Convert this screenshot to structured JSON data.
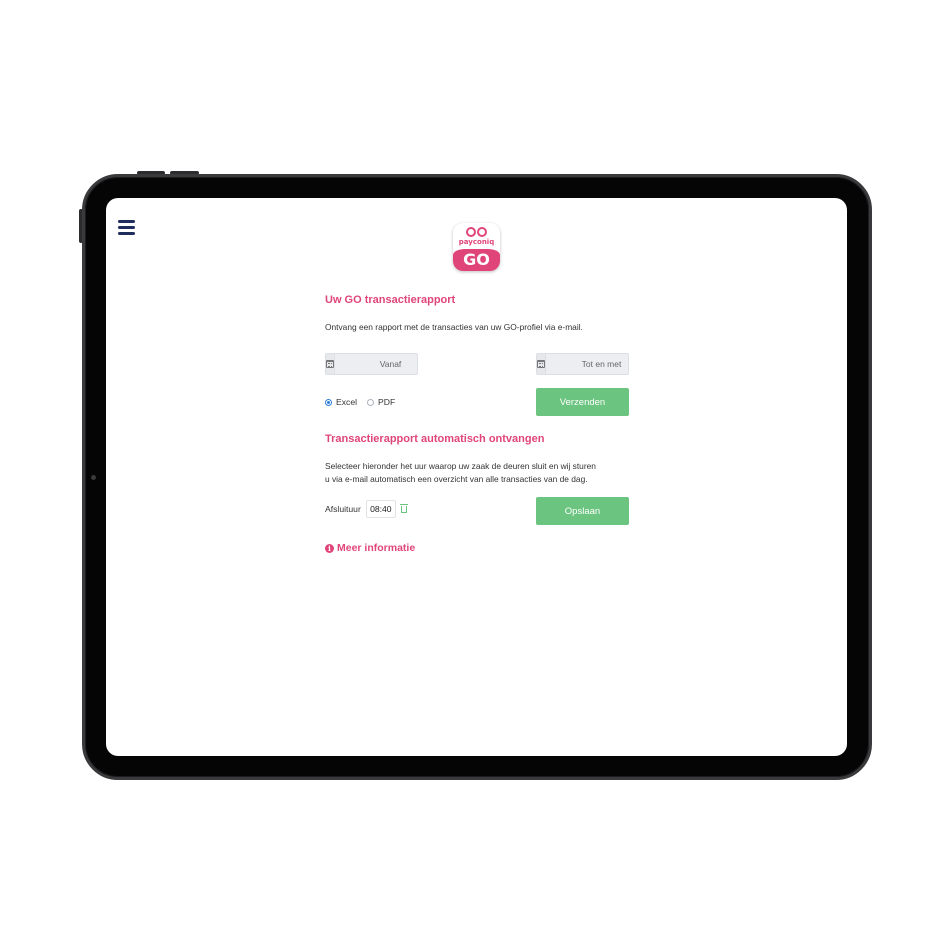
{
  "app": {
    "brand_word": "payconiq",
    "brand_badge": "GO"
  },
  "report": {
    "title": "Uw GO transactierapport",
    "description": "Ontvang een rapport met de transacties van uw GO-profiel via e-mail.",
    "from_placeholder": "Vanaf",
    "to_placeholder": "Tot en met",
    "format_options": [
      {
        "label": "Excel",
        "selected": true
      },
      {
        "label": "PDF",
        "selected": false
      }
    ],
    "send_label": "Verzenden"
  },
  "auto": {
    "title": "Transactierapport automatisch ontvangen",
    "description_line1": "Selecteer hieronder het uur waarop uw zaak de deuren sluit en wij sturen",
    "description_line2": "u via e-mail automatisch een overzicht van alle transacties van de dag.",
    "closing_label": "Afsluituur",
    "closing_time": "08:40",
    "save_label": "Opslaan"
  },
  "more_info": {
    "icon_glyph": "i",
    "label": "Meer informatie"
  },
  "colors": {
    "brand_pink": "#e0457a",
    "button_green": "#6bc47f",
    "menu_navy": "#1f2d5c"
  },
  "icons": [
    "hamburger-menu-icon",
    "calendar-icon",
    "trash-icon",
    "info-icon"
  ]
}
